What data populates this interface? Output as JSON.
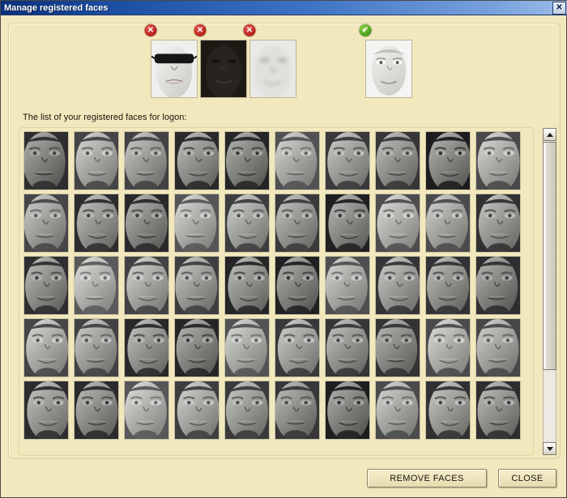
{
  "window": {
    "title": "Manage registered faces",
    "close_icon": "close-icon",
    "close_glyph": "✕"
  },
  "examples": {
    "bad_badge_glyph": "✕",
    "good_badge_glyph": "✔",
    "items": [
      {
        "id": "sunglasses",
        "status": "bad",
        "badge": "red-x-badge",
        "description": "Face wearing dark sunglasses"
      },
      {
        "id": "too-dark",
        "status": "bad",
        "badge": "red-x-badge",
        "description": "Face that is too dark / underexposed"
      },
      {
        "id": "overexposed",
        "status": "bad",
        "badge": "red-x-badge",
        "description": "Face that is washed out / blurry"
      },
      {
        "id": "good",
        "status": "good",
        "badge": "green-check-badge",
        "description": "Well lit, clear, frontal face"
      }
    ]
  },
  "list": {
    "label": "The list of your registered faces for logon:",
    "columns": 10,
    "rows": 5,
    "total_thumbnails": 50
  },
  "scrollbar": {
    "up_arrow": "scroll-up-arrow",
    "down_arrow": "scroll-down-arrow",
    "thumb_position_percent": 0,
    "thumb_size_percent": 75
  },
  "buttons": {
    "remove_faces": "REMOVE FACES",
    "close": "CLOSE"
  },
  "colors": {
    "dialog_background": "#f2e8bd",
    "titlebar_start": "#0a2e7a",
    "titlebar_end": "#9dbce8",
    "bad_badge": "#b61d16",
    "good_badge": "#3f9a15",
    "button_face": "#eee4b6"
  }
}
